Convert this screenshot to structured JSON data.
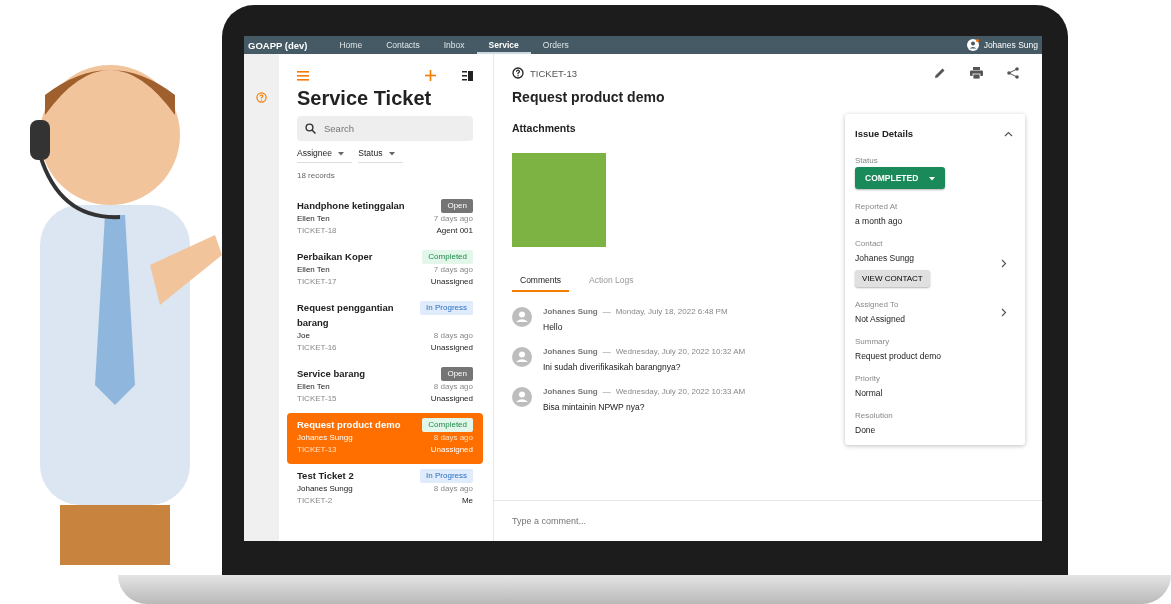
{
  "nav": {
    "brand": "GOAPP (dev)",
    "items": [
      {
        "label": "Home",
        "selected": false
      },
      {
        "label": "Contacts",
        "selected": false
      },
      {
        "label": "Inbox",
        "selected": false
      },
      {
        "label": "Service",
        "selected": true
      },
      {
        "label": "Orders",
        "selected": false
      }
    ],
    "user": "Johanes Sung"
  },
  "list": {
    "title": "Service Ticket",
    "search": {
      "placeholder": "Search"
    },
    "filters": [
      "Assignee",
      "Status"
    ],
    "count": "18 records",
    "tickets": [
      {
        "title": "Handphone ketinggalan",
        "status": "Open",
        "kind": "open",
        "contact": "Ellen Ten",
        "time": "7 days ago",
        "id": "TICKET-18",
        "assignee": "Agent 001",
        "selected": false
      },
      {
        "title": "Perbaikan Koper",
        "status": "Completed",
        "kind": "completed",
        "contact": "Ellen Ten",
        "time": "7 days ago",
        "id": "TICKET-17",
        "assignee": "Unassigned",
        "selected": false
      },
      {
        "title": "Request penggantian barang",
        "status": "In Progress",
        "kind": "in_progress",
        "contact": "Joe",
        "time": "8 days ago",
        "id": "TICKET-16",
        "assignee": "Unassigned",
        "selected": false
      },
      {
        "title": "Service barang",
        "status": "Open",
        "kind": "open",
        "contact": "Ellen Ten",
        "time": "8 days ago",
        "id": "TICKET-15",
        "assignee": "Unassigned",
        "selected": false
      },
      {
        "title": "Request product demo",
        "status": "Completed",
        "kind": "completed",
        "contact": "Johanes Sungg",
        "time": "8 days ago",
        "id": "TICKET-13",
        "assignee": "Unassigned",
        "selected": true
      },
      {
        "title": "Test Ticket 2",
        "status": "In Progress",
        "kind": "in_progress",
        "contact": "Johanes Sungg",
        "time": "8 days ago",
        "id": "TICKET-2",
        "assignee": "Me",
        "selected": false
      }
    ]
  },
  "detail": {
    "ticket_id": "TICKET-13",
    "title": "Request product demo",
    "attachments_heading": "Attachments",
    "tabs": [
      {
        "label": "Comments",
        "selected": true
      },
      {
        "label": "Action Logs",
        "selected": false
      }
    ],
    "comments": [
      {
        "author": "Johanes Sung",
        "separator": "—",
        "time": "Monday, July 18, 2022 6:48 PM",
        "text": "Hello"
      },
      {
        "author": "Johanes Sung",
        "separator": "—",
        "time": "Wednesday, July 20, 2022 10:32 AM",
        "text": "Ini sudah diverifikasikah barangnya?"
      },
      {
        "author": "Johanes Sung",
        "separator": "—",
        "time": "Wednesday, July 20, 2022 10:33 AM",
        "text": "Bisa mintainin NPWP nya?"
      }
    ],
    "comment_input": {
      "placeholder": "Type a comment..."
    }
  },
  "issue_details": {
    "title": "Issue Details",
    "expanded": true,
    "status": {
      "label": "Status",
      "value": "COMPLETED"
    },
    "fields": [
      {
        "label": "Reported At",
        "value": "a month ago",
        "chevron": false
      },
      {
        "label": "Contact",
        "value": "Johanes Sungg",
        "chevron": true,
        "button": "VIEW CONTACT"
      },
      {
        "label": "Assigned To",
        "value": "Not Assigned",
        "chevron": true
      },
      {
        "label": "Summary",
        "value": "Request product demo",
        "chevron": false
      },
      {
        "label": "Priority",
        "value": "Normal",
        "chevron": false
      },
      {
        "label": "Resolution",
        "value": "Done",
        "chevron": false
      }
    ]
  }
}
